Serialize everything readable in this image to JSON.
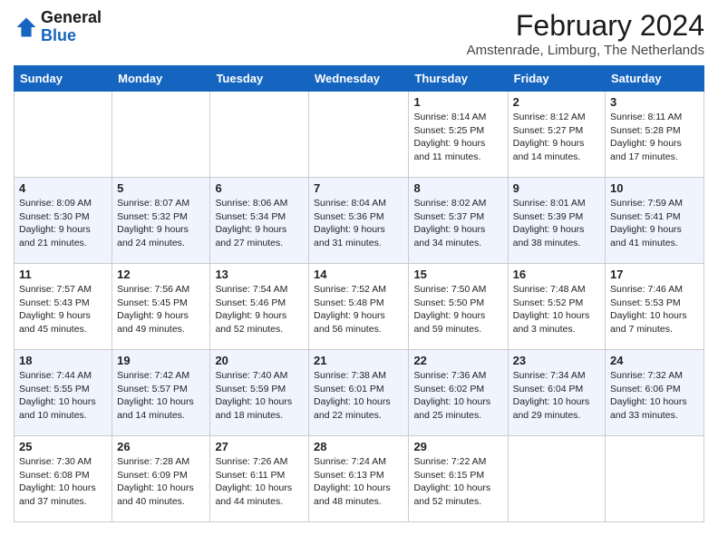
{
  "header": {
    "logo_line1": "General",
    "logo_line2": "Blue",
    "month": "February 2024",
    "location": "Amstenrade, Limburg, The Netherlands"
  },
  "days_of_week": [
    "Sunday",
    "Monday",
    "Tuesday",
    "Wednesday",
    "Thursday",
    "Friday",
    "Saturday"
  ],
  "weeks": [
    [
      {
        "num": "",
        "content": ""
      },
      {
        "num": "",
        "content": ""
      },
      {
        "num": "",
        "content": ""
      },
      {
        "num": "",
        "content": ""
      },
      {
        "num": "1",
        "content": "Sunrise: 8:14 AM\nSunset: 5:25 PM\nDaylight: 9 hours\nand 11 minutes."
      },
      {
        "num": "2",
        "content": "Sunrise: 8:12 AM\nSunset: 5:27 PM\nDaylight: 9 hours\nand 14 minutes."
      },
      {
        "num": "3",
        "content": "Sunrise: 8:11 AM\nSunset: 5:28 PM\nDaylight: 9 hours\nand 17 minutes."
      }
    ],
    [
      {
        "num": "4",
        "content": "Sunrise: 8:09 AM\nSunset: 5:30 PM\nDaylight: 9 hours\nand 21 minutes."
      },
      {
        "num": "5",
        "content": "Sunrise: 8:07 AM\nSunset: 5:32 PM\nDaylight: 9 hours\nand 24 minutes."
      },
      {
        "num": "6",
        "content": "Sunrise: 8:06 AM\nSunset: 5:34 PM\nDaylight: 9 hours\nand 27 minutes."
      },
      {
        "num": "7",
        "content": "Sunrise: 8:04 AM\nSunset: 5:36 PM\nDaylight: 9 hours\nand 31 minutes."
      },
      {
        "num": "8",
        "content": "Sunrise: 8:02 AM\nSunset: 5:37 PM\nDaylight: 9 hours\nand 34 minutes."
      },
      {
        "num": "9",
        "content": "Sunrise: 8:01 AM\nSunset: 5:39 PM\nDaylight: 9 hours\nand 38 minutes."
      },
      {
        "num": "10",
        "content": "Sunrise: 7:59 AM\nSunset: 5:41 PM\nDaylight: 9 hours\nand 41 minutes."
      }
    ],
    [
      {
        "num": "11",
        "content": "Sunrise: 7:57 AM\nSunset: 5:43 PM\nDaylight: 9 hours\nand 45 minutes."
      },
      {
        "num": "12",
        "content": "Sunrise: 7:56 AM\nSunset: 5:45 PM\nDaylight: 9 hours\nand 49 minutes."
      },
      {
        "num": "13",
        "content": "Sunrise: 7:54 AM\nSunset: 5:46 PM\nDaylight: 9 hours\nand 52 minutes."
      },
      {
        "num": "14",
        "content": "Sunrise: 7:52 AM\nSunset: 5:48 PM\nDaylight: 9 hours\nand 56 minutes."
      },
      {
        "num": "15",
        "content": "Sunrise: 7:50 AM\nSunset: 5:50 PM\nDaylight: 9 hours\nand 59 minutes."
      },
      {
        "num": "16",
        "content": "Sunrise: 7:48 AM\nSunset: 5:52 PM\nDaylight: 10 hours\nand 3 minutes."
      },
      {
        "num": "17",
        "content": "Sunrise: 7:46 AM\nSunset: 5:53 PM\nDaylight: 10 hours\nand 7 minutes."
      }
    ],
    [
      {
        "num": "18",
        "content": "Sunrise: 7:44 AM\nSunset: 5:55 PM\nDaylight: 10 hours\nand 10 minutes."
      },
      {
        "num": "19",
        "content": "Sunrise: 7:42 AM\nSunset: 5:57 PM\nDaylight: 10 hours\nand 14 minutes."
      },
      {
        "num": "20",
        "content": "Sunrise: 7:40 AM\nSunset: 5:59 PM\nDaylight: 10 hours\nand 18 minutes."
      },
      {
        "num": "21",
        "content": "Sunrise: 7:38 AM\nSunset: 6:01 PM\nDaylight: 10 hours\nand 22 minutes."
      },
      {
        "num": "22",
        "content": "Sunrise: 7:36 AM\nSunset: 6:02 PM\nDaylight: 10 hours\nand 25 minutes."
      },
      {
        "num": "23",
        "content": "Sunrise: 7:34 AM\nSunset: 6:04 PM\nDaylight: 10 hours\nand 29 minutes."
      },
      {
        "num": "24",
        "content": "Sunrise: 7:32 AM\nSunset: 6:06 PM\nDaylight: 10 hours\nand 33 minutes."
      }
    ],
    [
      {
        "num": "25",
        "content": "Sunrise: 7:30 AM\nSunset: 6:08 PM\nDaylight: 10 hours\nand 37 minutes."
      },
      {
        "num": "26",
        "content": "Sunrise: 7:28 AM\nSunset: 6:09 PM\nDaylight: 10 hours\nand 40 minutes."
      },
      {
        "num": "27",
        "content": "Sunrise: 7:26 AM\nSunset: 6:11 PM\nDaylight: 10 hours\nand 44 minutes."
      },
      {
        "num": "28",
        "content": "Sunrise: 7:24 AM\nSunset: 6:13 PM\nDaylight: 10 hours\nand 48 minutes."
      },
      {
        "num": "29",
        "content": "Sunrise: 7:22 AM\nSunset: 6:15 PM\nDaylight: 10 hours\nand 52 minutes."
      },
      {
        "num": "",
        "content": ""
      },
      {
        "num": "",
        "content": ""
      }
    ]
  ]
}
